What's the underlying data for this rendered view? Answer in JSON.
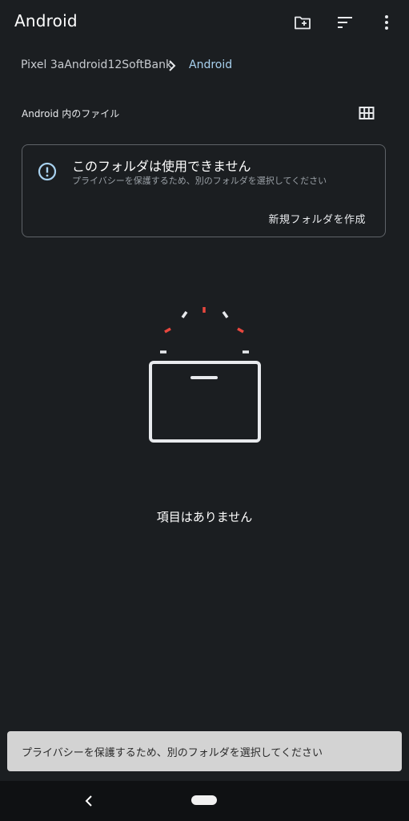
{
  "appbar": {
    "title": "Android",
    "icons": [
      "new-folder-icon",
      "sort-icon",
      "more-vert-icon"
    ]
  },
  "breadcrumb": {
    "root": "Pixel 3aAndroid12SoftBank",
    "current": "Android"
  },
  "section": {
    "header": "Android 内のファイル",
    "view_toggle_icon": "grid-view-icon"
  },
  "warning_card": {
    "icon": "error-outline-icon",
    "title": "このフォルダは使用できません",
    "description": "プライバシーを保護するため、別のフォルダを選択してください",
    "action": "新規フォルダを作成"
  },
  "empty_state": {
    "illustration": "empty-box-illustration",
    "text": "項目はありません"
  },
  "snackbar": {
    "text": "プライバシーを保護するため、別のフォルダを選択してください"
  },
  "navbar": {
    "icons": [
      "back-icon",
      "home-pill"
    ]
  },
  "colors": {
    "background": "#1b1e21",
    "accent": "#a8d1ef",
    "sparkle_red": "#e8473e",
    "snackbar": "#d3d3d3"
  }
}
